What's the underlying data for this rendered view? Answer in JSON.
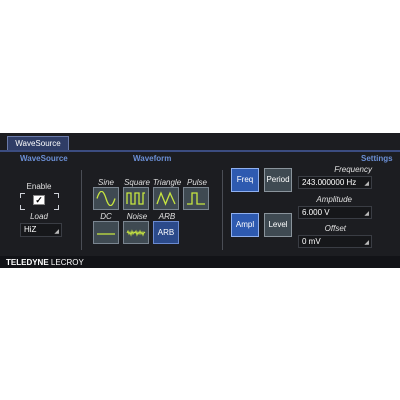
{
  "tab": {
    "label": "WaveSource"
  },
  "sections": {
    "wavesource": "WaveSource",
    "waveform": "Waveform",
    "settings": "Settings"
  },
  "wavesource": {
    "enable_label": "Enable",
    "enable_checked": true,
    "load_label": "Load",
    "load_value": "HiZ"
  },
  "waveform": {
    "shapes": [
      {
        "label": "Sine",
        "icon": "sine-wave-icon"
      },
      {
        "label": "Square",
        "icon": "square-wave-icon"
      },
      {
        "label": "Triangle",
        "icon": "triangle-wave-icon"
      },
      {
        "label": "Pulse",
        "icon": "pulse-wave-icon"
      },
      {
        "label": "DC",
        "icon": "dc-line-icon"
      },
      {
        "label": "Noise",
        "icon": "noise-wave-icon"
      },
      {
        "label": "ARB",
        "button_text": "ARB"
      }
    ],
    "selected": "ARB"
  },
  "settings": {
    "freq_button": "Freq",
    "period_button": "Period",
    "ampl_button": "Ampl",
    "level_button": "Level",
    "frequency_label": "Frequency",
    "frequency_value": "243.000000 Hz",
    "amplitude_label": "Amplitude",
    "amplitude_value": "6.000 V",
    "offset_label": "Offset",
    "offset_value": "0 mV"
  },
  "brand": {
    "part1": "TELEDYNE",
    "part2": "LECROY"
  },
  "colors": {
    "panel_bg": "#1c1d21",
    "accent": "#2e5ab0",
    "section_title": "#6b8fd6",
    "wave_stroke": "#c8e640"
  }
}
